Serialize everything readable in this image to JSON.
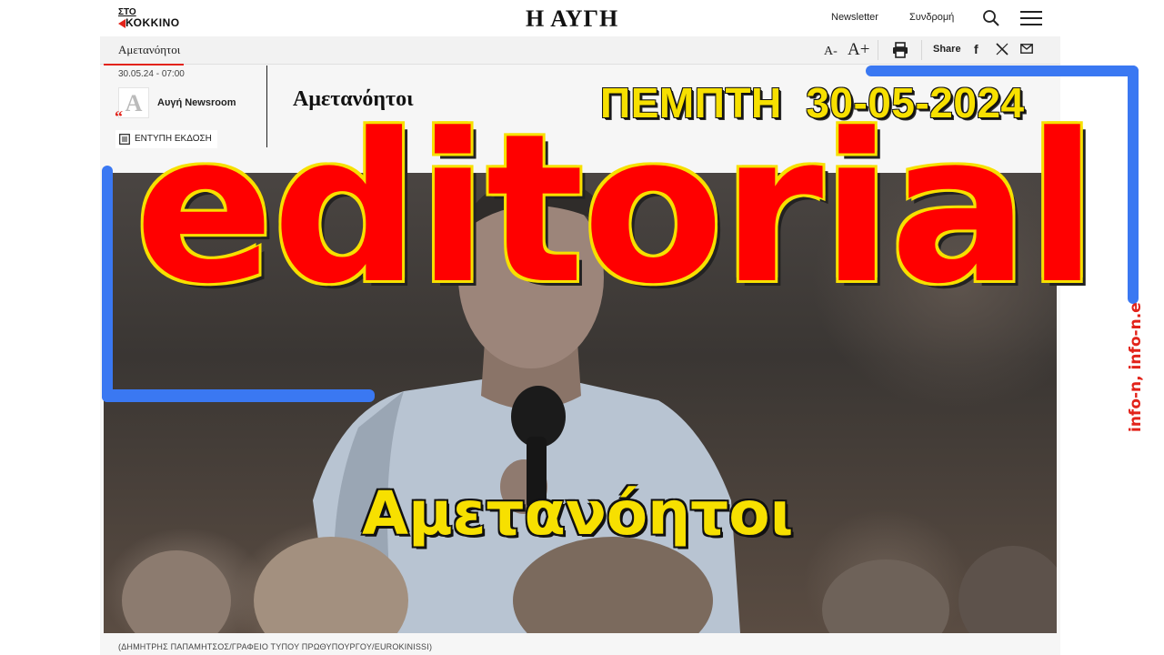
{
  "header": {
    "logo_line1": "ΣΤΟ",
    "logo_line2": "ΚΟΚΚΙΝΟ",
    "site_title": "Η ΑΥΓΗ",
    "newsletter": "Newsletter",
    "subscribe": "Συνδρομή",
    "icons": [
      "search-icon",
      "menu-icon"
    ]
  },
  "subbar": {
    "breadcrumb": "Αμετανόητοι",
    "font_decrease": "A-",
    "font_increase": "A+",
    "share_label": "Share",
    "social_icons": [
      "print-icon",
      "facebook-icon",
      "x-icon",
      "mail-icon"
    ]
  },
  "article": {
    "date": "30.05.24 - 07:00",
    "author_initial": "A",
    "author": "Αυγή Newsroom",
    "print_edition": "ΕΝΤΥΠΗ ΕΚΔΟΣΗ",
    "title": "Αμετανόητοι",
    "photo_caption": "(ΔΗΜΗΤΡΗΣ ΠΑΠΑΜΗΤΣΟΣ/ΓΡΑΦΕΙΟ ΤΥΠΟΥ ΠΡΩΘΥΠΟΥΡΓΟΥ/EUROKINISSI)"
  },
  "overlay": {
    "date": "ΠΕΜΠΤΗ  30-05-2024",
    "headline": "editorial",
    "subtitle": "Αμετανόητοι",
    "watermark": "info-n, info-n.e"
  },
  "colors": {
    "accent_red": "#e2231a",
    "overlay_red": "#ff0000",
    "overlay_yellow": "#f7e000",
    "frame_blue": "#3a78f2"
  }
}
